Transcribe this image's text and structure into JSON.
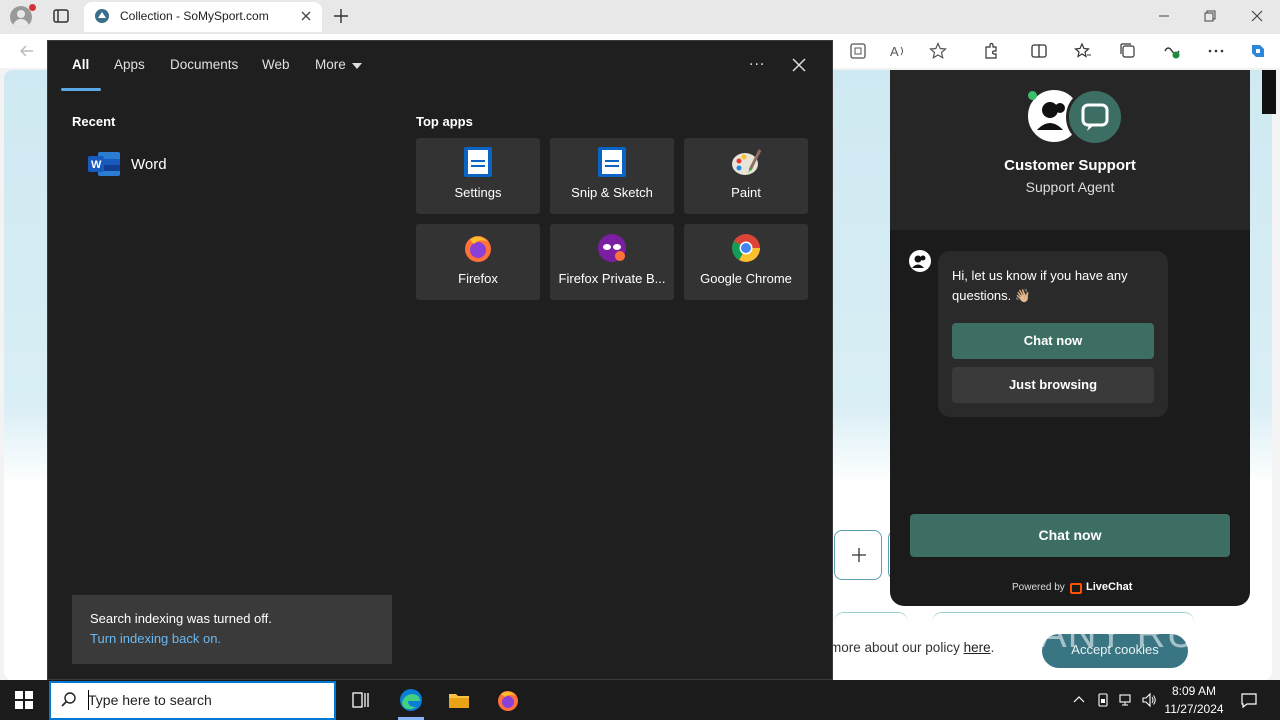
{
  "browser": {
    "tab_title": "Collection - SoMySport.com"
  },
  "search_flyout": {
    "tabs": [
      {
        "label": "All"
      },
      {
        "label": "Apps"
      },
      {
        "label": "Documents"
      },
      {
        "label": "Web"
      },
      {
        "label": "More"
      }
    ],
    "more_options": "···",
    "recent_heading": "Recent",
    "recent_items": [
      {
        "label": "Word",
        "icon": "word-icon"
      }
    ],
    "top_apps_heading": "Top apps",
    "top_apps": [
      {
        "label": "Settings",
        "icon": "settings-doc-icon"
      },
      {
        "label": "Snip & Sketch",
        "icon": "snip-sketch-icon"
      },
      {
        "label": "Paint",
        "icon": "paint-palette-icon"
      },
      {
        "label": "Firefox",
        "icon": "firefox-icon"
      },
      {
        "label": "Firefox Private B...",
        "icon": "firefox-private-icon"
      },
      {
        "label": "Google Chrome",
        "icon": "chrome-icon"
      }
    ],
    "indexing_notice": "Search indexing was turned off.",
    "indexing_link": "Turn indexing back on."
  },
  "chat_widget": {
    "agent_name": "Customer Support",
    "agent_role": "Support Agent",
    "message": "Hi, let us know if you have any questions. 👋🏼",
    "chat_now_small": "Chat now",
    "just_browsing": "Just browsing",
    "chat_now_big": "Chat now",
    "powered_by": "Powered by",
    "provider": "LiveChat"
  },
  "page": {
    "policy_text": "more about our policy ",
    "policy_link": "here",
    "policy_end": ".",
    "accept_cookies": "Accept cookies"
  },
  "watermark": "ANY RUN",
  "taskbar": {
    "search_placeholder": "Type here to search",
    "time": "8:09 AM",
    "date": "11/27/2024"
  },
  "colors": {
    "accent": "#0078d4",
    "chat_green": "#3d6e64",
    "flyout_bg": "#1f1f1f"
  }
}
